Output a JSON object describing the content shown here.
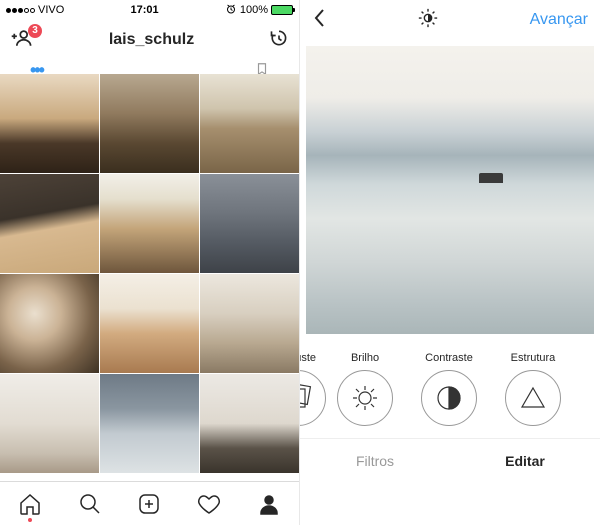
{
  "status": {
    "carrier": "VIVO",
    "time": "17:01",
    "battery_pct": "100%"
  },
  "profile": {
    "username": "lais_schulz",
    "friend_badge": "3"
  },
  "tabbar": {
    "home": "home",
    "search": "search",
    "add": "add",
    "activity": "activity",
    "profile": "profile"
  },
  "edit": {
    "advance_label": "Avançar",
    "tools": {
      "adjust": "Ajuste",
      "brightness": "Brilho",
      "contrast": "Contraste",
      "structure": "Estrutura"
    },
    "modes": {
      "filters": "Filtros",
      "edit": "Editar"
    }
  }
}
